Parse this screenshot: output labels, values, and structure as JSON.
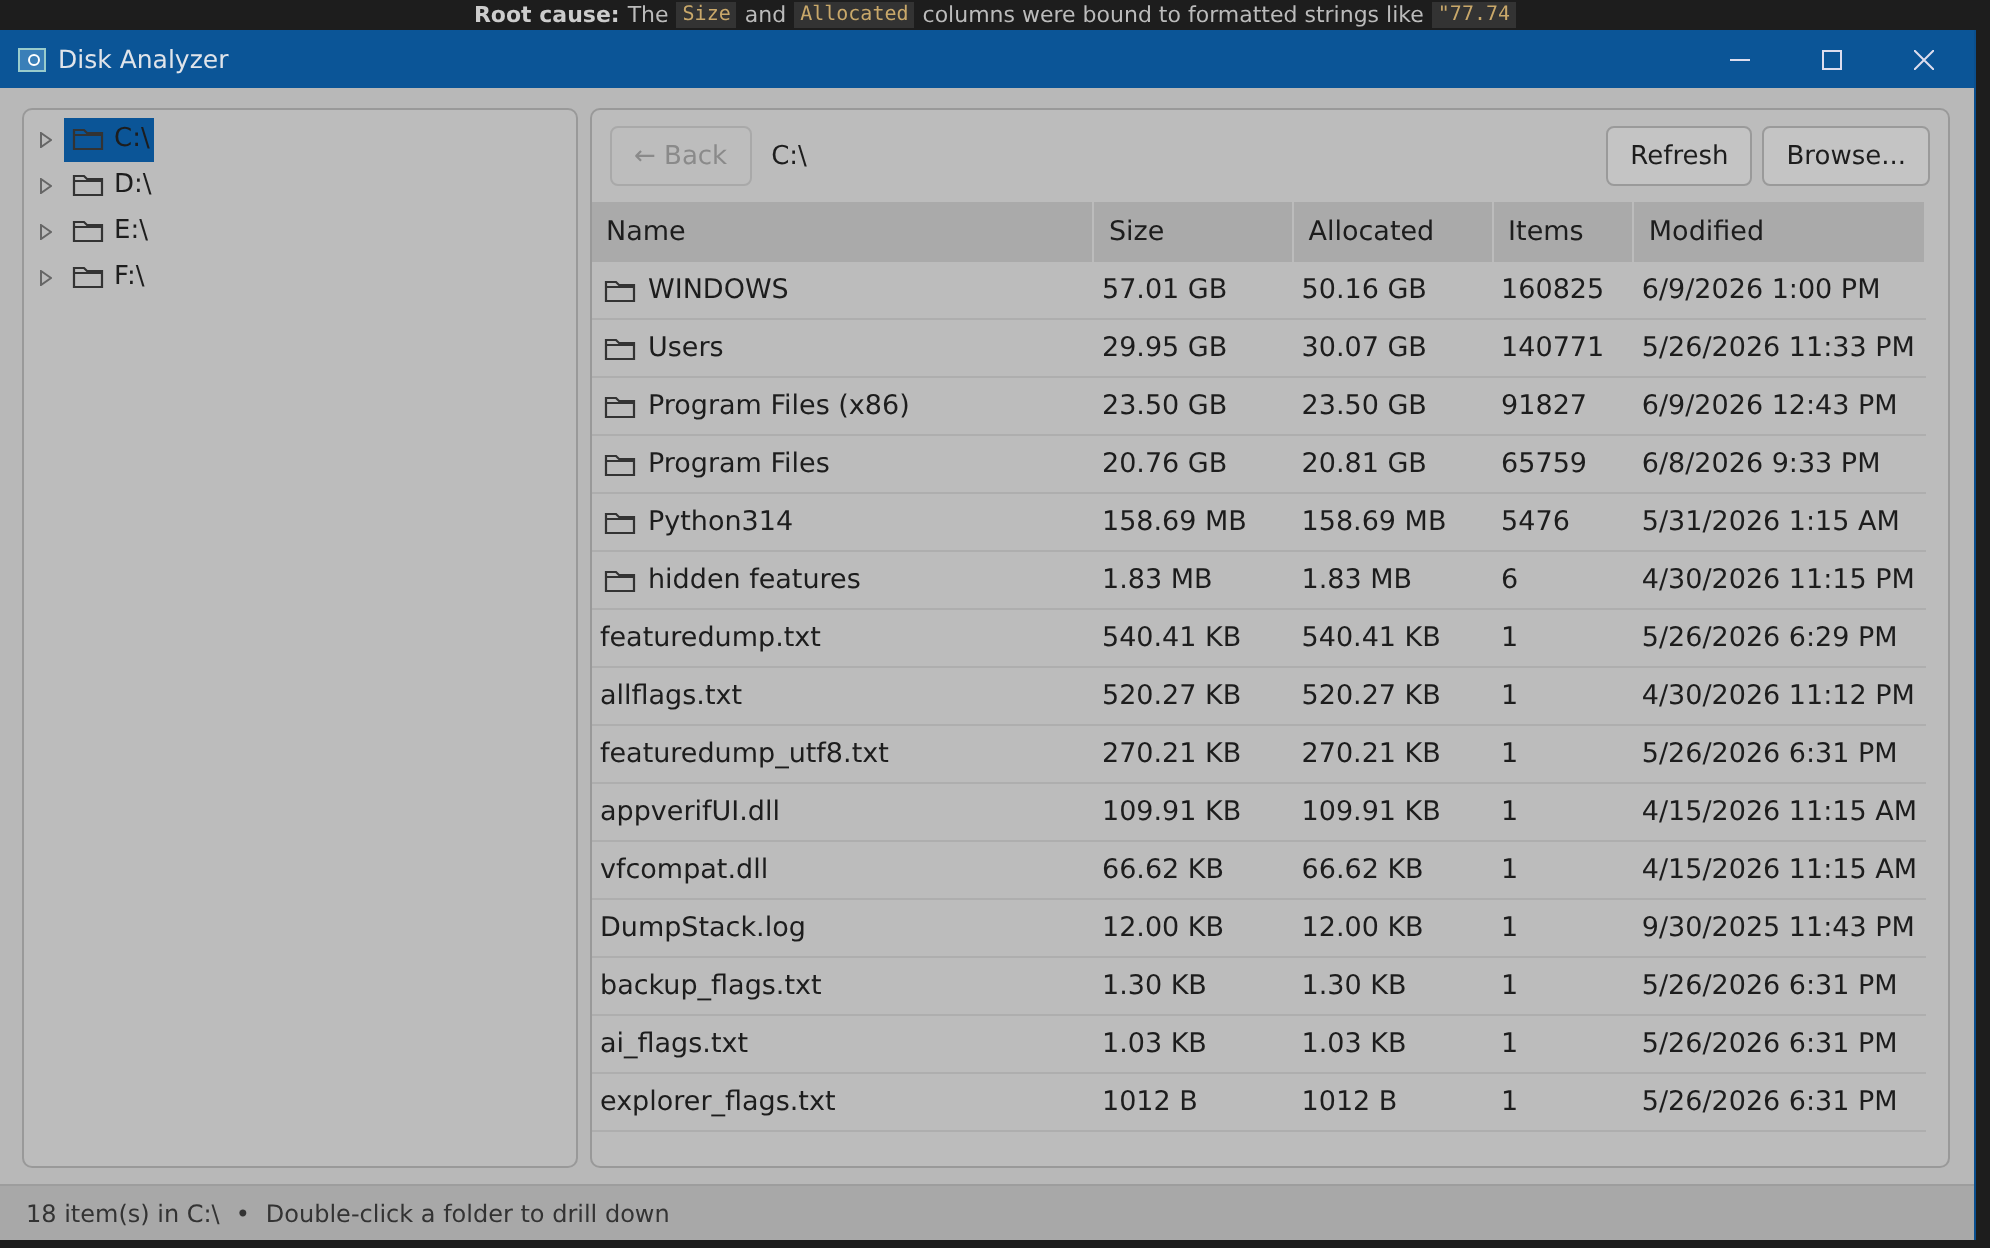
{
  "background_text": [
    {
      "kind": "bold",
      "text": "Root cause:"
    },
    {
      "kind": "plain",
      "text": "The"
    },
    {
      "kind": "code",
      "text": "Size"
    },
    {
      "kind": "plain",
      "text": "and"
    },
    {
      "kind": "code",
      "text": "Allocated"
    },
    {
      "kind": "plain",
      "text": "columns were bound to formatted strings like"
    },
    {
      "kind": "code",
      "text": "\"77.74"
    }
  ],
  "window": {
    "title": "Disk Analyzer"
  },
  "tree": [
    {
      "label": "C:\\",
      "selected": true,
      "expanded": false
    },
    {
      "label": "D:\\",
      "selected": false,
      "expanded": false
    },
    {
      "label": "E:\\",
      "selected": false,
      "expanded": false
    },
    {
      "label": "F:\\",
      "selected": false,
      "expanded": false
    }
  ],
  "toolbar": {
    "back": {
      "label": "← Back",
      "disabled": true
    },
    "path": "C:\\",
    "buttons": [
      "Refresh",
      "Browse..."
    ]
  },
  "table": {
    "columns": [
      "Name",
      "Size",
      "Allocated",
      "Items",
      "Modified"
    ],
    "rows": [
      {
        "kind": "folder",
        "cells": [
          "WINDOWS",
          "57.01 GB",
          "50.16 GB",
          "160825",
          "6/9/2026 1:00 PM"
        ]
      },
      {
        "kind": "folder",
        "cells": [
          "Users",
          "29.95 GB",
          "30.07 GB",
          "140771",
          "5/26/2026 11:33 PM"
        ]
      },
      {
        "kind": "folder",
        "cells": [
          "Program Files (x86)",
          "23.50 GB",
          "23.50 GB",
          "91827",
          "6/9/2026 12:43 PM"
        ]
      },
      {
        "kind": "folder",
        "cells": [
          "Program Files",
          "20.76 GB",
          "20.81 GB",
          "65759",
          "6/8/2026 9:33 PM"
        ]
      },
      {
        "kind": "folder",
        "cells": [
          "Python314",
          "158.69 MB",
          "158.69 MB",
          "5476",
          "5/31/2026 1:15 AM"
        ]
      },
      {
        "kind": "folder",
        "cells": [
          "hidden features",
          "1.83 MB",
          "1.83 MB",
          "6",
          "4/30/2026 11:15 PM"
        ]
      },
      {
        "kind": "file",
        "cells": [
          "featuredump.txt",
          "540.41 KB",
          "540.41 KB",
          "1",
          "5/26/2026 6:29 PM"
        ]
      },
      {
        "kind": "file",
        "cells": [
          "allflags.txt",
          "520.27 KB",
          "520.27 KB",
          "1",
          "4/30/2026 11:12 PM"
        ]
      },
      {
        "kind": "file",
        "cells": [
          "featuredump_utf8.txt",
          "270.21 KB",
          "270.21 KB",
          "1",
          "5/26/2026 6:31 PM"
        ]
      },
      {
        "kind": "file",
        "cells": [
          "appverifUI.dll",
          "109.91 KB",
          "109.91 KB",
          "1",
          "4/15/2026 11:15 AM"
        ]
      },
      {
        "kind": "file",
        "cells": [
          "vfcompat.dll",
          "66.62 KB",
          "66.62 KB",
          "1",
          "4/15/2026 11:15 AM"
        ]
      },
      {
        "kind": "file",
        "cells": [
          "DumpStack.log",
          "12.00 KB",
          "12.00 KB",
          "1",
          "9/30/2025 11:43 PM"
        ]
      },
      {
        "kind": "file",
        "cells": [
          "backup_flags.txt",
          "1.30 KB",
          "1.30 KB",
          "1",
          "5/26/2026 6:31 PM"
        ]
      },
      {
        "kind": "file",
        "cells": [
          "ai_flags.txt",
          "1.03 KB",
          "1.03 KB",
          "1",
          "5/26/2026 6:31 PM"
        ]
      },
      {
        "kind": "file",
        "cells": [
          "explorer_flags.txt",
          "1012 B",
          "1012 B",
          "1",
          "5/26/2026 6:31 PM"
        ]
      }
    ]
  },
  "status_bar": {
    "count": "18 item(s) in C:\\",
    "separator": "•",
    "hint": "Double-click a folder to drill down"
  }
}
